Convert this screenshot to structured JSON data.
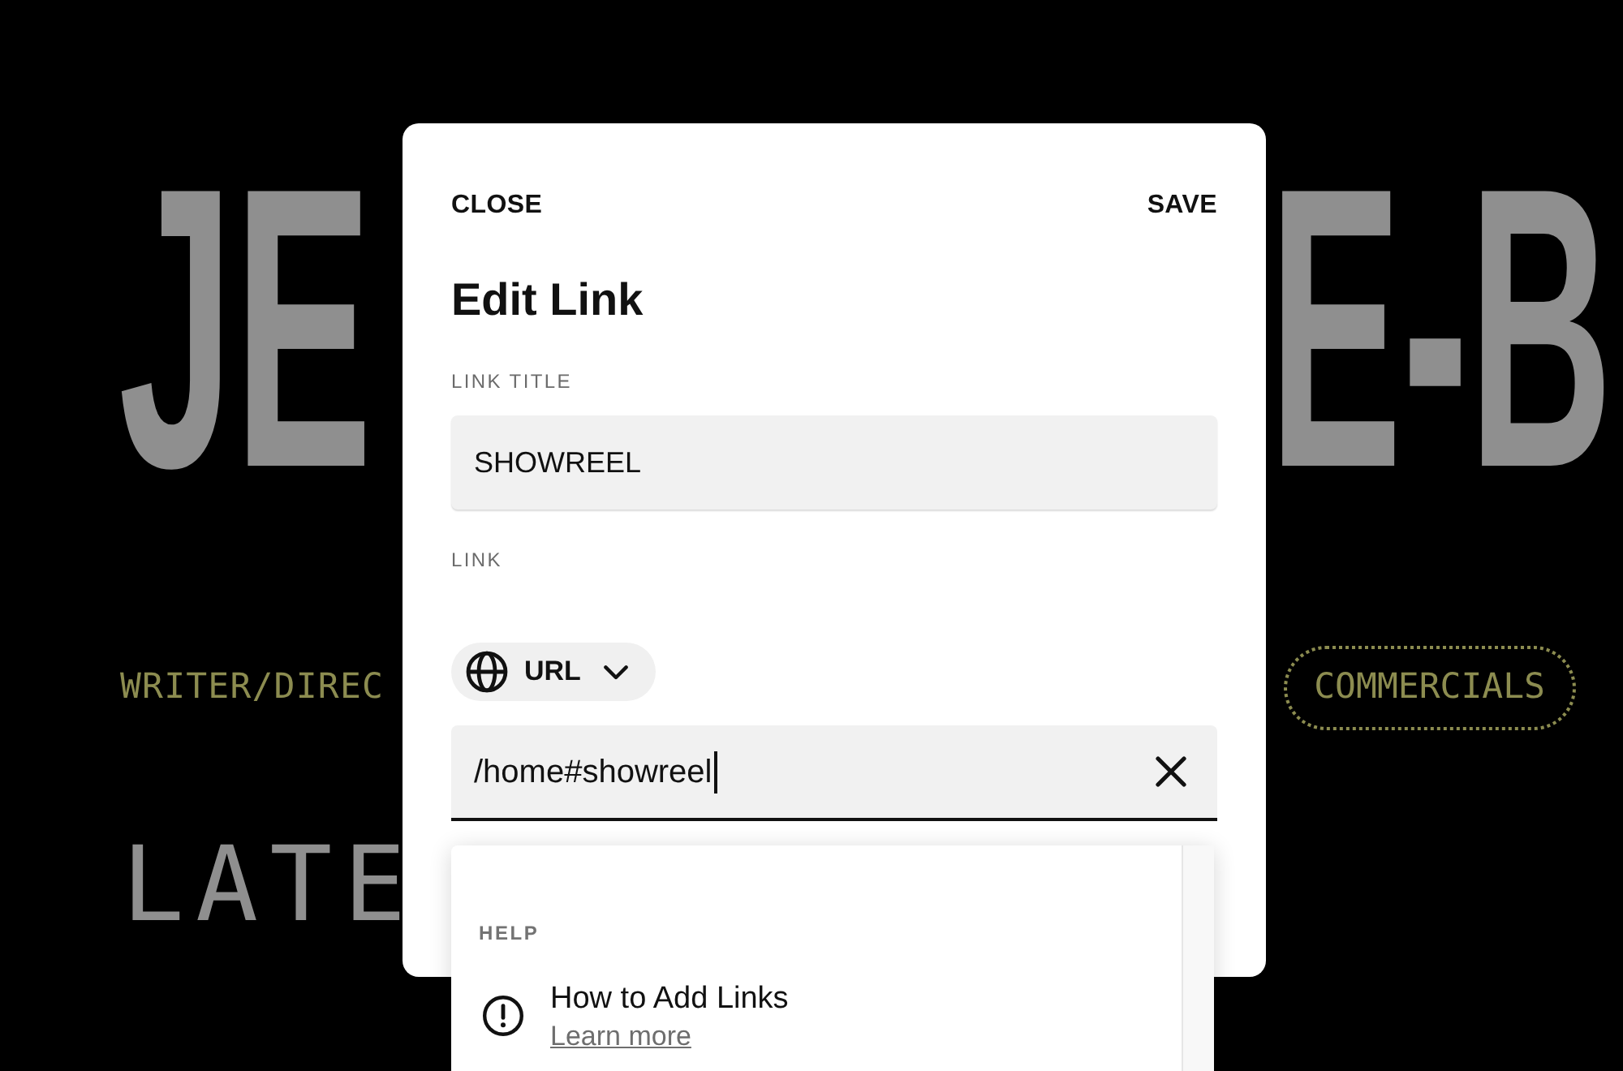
{
  "background": {
    "name_heading_left": "JE",
    "name_heading_right": "E-B",
    "role": "WRITER/DIREC",
    "category_button": "COMMERCIALS",
    "section_heading": "LATE"
  },
  "dialog": {
    "close_button": "CLOSE",
    "save_button": "SAVE",
    "title": "Edit Link",
    "title_field": {
      "label": "LINK TITLE",
      "value": "SHOWREEL",
      "focused": false
    },
    "link_field": {
      "label": "LINK",
      "type_selector": "URL",
      "value": "/home#showreel",
      "focused": true
    }
  },
  "suggestions": {
    "section": "HELP",
    "items": [
      {
        "title": "How to Add Links",
        "link": "Learn more"
      }
    ]
  }
}
